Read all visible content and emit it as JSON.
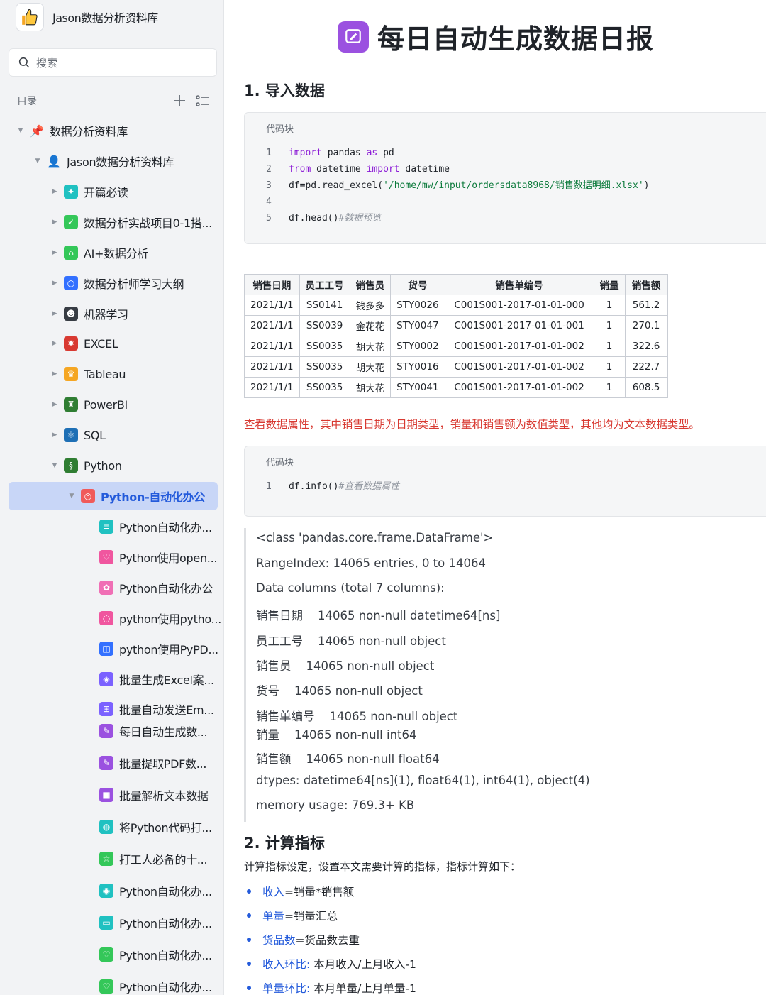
{
  "app": {
    "title": "Jason数据分析资料库",
    "logo_icon": "thumbs-up-icon"
  },
  "search": {
    "placeholder": "搜索"
  },
  "toc": {
    "title": "目录"
  },
  "tree": [
    {
      "label": "数据分析资料库",
      "level": 0,
      "arrow": "▼",
      "icon": "pin-icon",
      "glyph": "📌",
      "color": "transparent"
    },
    {
      "label": "Jason数据分析资料库",
      "level": 1,
      "arrow": "▼",
      "icon": "user-icon",
      "glyph": "👤",
      "color": "transparent"
    },
    {
      "label": "开篇必读",
      "level": 2,
      "arrow": "▶",
      "icon": "book-icon",
      "glyph": "✦",
      "color": "#20c1c1"
    },
    {
      "label": "数据分析实战项目0-1搭...",
      "level": 2,
      "arrow": "▶",
      "icon": "check-icon",
      "glyph": "✓",
      "color": "#34c759"
    },
    {
      "label": "AI+数据分析",
      "level": 2,
      "arrow": "▶",
      "icon": "home-icon",
      "glyph": "⌂",
      "color": "#34c759"
    },
    {
      "label": "数据分析师学习大纲",
      "level": 2,
      "arrow": "▶",
      "icon": "circle-icon",
      "glyph": "○",
      "color": "#3370ff"
    },
    {
      "label": "机器学习",
      "level": 2,
      "arrow": "▶",
      "icon": "mask-icon",
      "glyph": "☻",
      "color": "#373c43"
    },
    {
      "label": "EXCEL",
      "level": 2,
      "arrow": "▶",
      "icon": "bug-icon",
      "glyph": "✹",
      "color": "#d83931"
    },
    {
      "label": "Tableau",
      "level": 2,
      "arrow": "▶",
      "icon": "crown-icon",
      "glyph": "♛",
      "color": "#f5a623"
    },
    {
      "label": "PowerBI",
      "level": 2,
      "arrow": "▶",
      "icon": "trophy-icon",
      "glyph": "♜",
      "color": "#2f7d32"
    },
    {
      "label": "SQL",
      "level": 2,
      "arrow": "▶",
      "icon": "atom-icon",
      "glyph": "⚛",
      "color": "#1e6fb5"
    },
    {
      "label": "Python",
      "level": 2,
      "arrow": "▼",
      "icon": "snake-icon",
      "glyph": "§",
      "color": "#2f7d32"
    },
    {
      "label": "Python-自动化办公",
      "level": 3,
      "arrow": "▼",
      "icon": "target-icon",
      "glyph": "◎",
      "color": "#f05a5a",
      "selected": true
    },
    {
      "label": "Python自动化办...",
      "level": 4,
      "arrow": "",
      "icon": "doc-icon",
      "glyph": "≡",
      "color": "#20c1c1"
    },
    {
      "label": "Python使用open...",
      "level": 4,
      "arrow": "",
      "icon": "heart-icon",
      "glyph": "♡",
      "color": "#f0569f"
    },
    {
      "label": "Python自动化办公",
      "level": 4,
      "arrow": "",
      "icon": "flower-icon",
      "glyph": "✿",
      "color": "#f06fb5"
    },
    {
      "label": "python使用pytho...",
      "level": 4,
      "arrow": "",
      "icon": "ring-icon",
      "glyph": "◌",
      "color": "#f0569f"
    },
    {
      "label": "python使用PyPD...",
      "level": 4,
      "arrow": "",
      "icon": "gamepad-icon",
      "glyph": "◫",
      "color": "#3370ff"
    },
    {
      "label": "批量生成Excel案...",
      "level": 4,
      "arrow": "",
      "icon": "shield-icon",
      "glyph": "◈",
      "color": "#7b61ff"
    },
    {
      "label": "批量自动发送Em...",
      "level": 4,
      "arrow": "",
      "icon": "grid-icon",
      "glyph": "⊞",
      "color": "#7b61ff"
    },
    {
      "label": "每日自动生成数...",
      "level": 4,
      "arrow": "",
      "icon": "chat-icon",
      "glyph": "✎",
      "color": "#9b51e0"
    },
    {
      "label": "批量提取PDF数...",
      "level": 4,
      "arrow": "",
      "icon": "edit-icon",
      "glyph": "✎",
      "color": "#9b51e0"
    },
    {
      "label": "批量解析文本数据",
      "level": 4,
      "arrow": "",
      "icon": "image-icon",
      "glyph": "▣",
      "color": "#9b51e0"
    },
    {
      "label": "将Python代码打...",
      "level": 4,
      "arrow": "",
      "icon": "package-icon",
      "glyph": "◍",
      "color": "#20c1c1"
    },
    {
      "label": "打工人必备的十...",
      "level": 4,
      "arrow": "",
      "icon": "star-icon",
      "glyph": "☆",
      "color": "#34c759"
    },
    {
      "label": "Python自动化办...",
      "level": 4,
      "arrow": "",
      "icon": "globe-icon",
      "glyph": "◉",
      "color": "#20c1c1"
    },
    {
      "label": "Python自动化办...",
      "level": 4,
      "arrow": "",
      "icon": "folder-icon",
      "glyph": "▭",
      "color": "#20c1c1"
    },
    {
      "label": "Python自动化办...",
      "level": 4,
      "arrow": "",
      "icon": "shield-check-icon",
      "glyph": "♡",
      "color": "#34c759"
    },
    {
      "label": "Python自动化办...",
      "level": 4,
      "arrow": "",
      "icon": "shield-check-icon",
      "glyph": "♡",
      "color": "#34c759"
    }
  ],
  "doc": {
    "title": "每日自动生成数据日报",
    "section1": "1. 导入数据",
    "code1_label": "代码块",
    "code1": [
      {
        "n": "1",
        "parts": [
          [
            "kw",
            "import"
          ],
          [
            "t",
            " pandas "
          ],
          [
            "kw",
            "as"
          ],
          [
            "t",
            " pd"
          ]
        ]
      },
      {
        "n": "2",
        "parts": [
          [
            "kw",
            "from"
          ],
          [
            "t",
            " datetime "
          ],
          [
            "kw",
            "import"
          ],
          [
            "t",
            " datetime"
          ]
        ]
      },
      {
        "n": "3",
        "parts": [
          [
            "t",
            "df=pd.read_excel("
          ],
          [
            "str",
            "'/home/mw/input/ordersdata8968/销售数据明细.xlsx'"
          ],
          [
            "t",
            ")"
          ]
        ]
      },
      {
        "n": "4",
        "parts": []
      },
      {
        "n": "5",
        "parts": [
          [
            "t",
            "df.head()"
          ],
          [
            "cmt",
            "#数据预览"
          ]
        ]
      }
    ],
    "table": {
      "headers": [
        "销售日期",
        "员工工号",
        "销售员",
        "货号",
        "销售单编号",
        "销量",
        "销售额"
      ],
      "rows": [
        [
          "2021/1/1",
          "SS0141",
          "钱多多",
          "STY0026",
          "C001S001-2017-01-01-000",
          "1",
          "561.2"
        ],
        [
          "2021/1/1",
          "SS0039",
          "金花花",
          "STY0047",
          "C001S001-2017-01-01-001",
          "1",
          "270.1"
        ],
        [
          "2021/1/1",
          "SS0035",
          "胡大花",
          "STY0002",
          "C001S001-2017-01-01-002",
          "1",
          "322.6"
        ],
        [
          "2021/1/1",
          "SS0035",
          "胡大花",
          "STY0016",
          "C001S001-2017-01-01-002",
          "1",
          "222.7"
        ],
        [
          "2021/1/1",
          "SS0035",
          "胡大花",
          "STY0041",
          "C001S001-2017-01-01-002",
          "1",
          "608.5"
        ]
      ]
    },
    "note": "查看数据属性，其中销售日期为日期类型，销量和销售额为数值类型，其他均为文本数据类型。",
    "code2_label": "代码块",
    "code2": [
      {
        "n": "1",
        "parts": [
          [
            "t",
            "df.info()"
          ],
          [
            "cmt",
            "#查看数据属性"
          ]
        ]
      }
    ],
    "output": [
      "<class 'pandas.core.frame.DataFrame'>",
      "RangeIndex: 14065 entries, 0 to 14064",
      "Data columns (total 7 columns):",
      "销售日期    14065 non-null datetime64[ns]",
      "员工工号    14065 non-null object",
      "销售员    14065 non-null object",
      "货号    14065 non-null object",
      "销售单编号    14065 non-null object",
      "销量    14065 non-null int64",
      "销售额    14065 non-null float64",
      "dtypes: datetime64[ns](1), float64(1), int64(1), object(4)",
      "memory usage: 769.3+ KB"
    ],
    "section2": "2. 计算指标",
    "para": "计算指标设定，设置本文需要计算的指标，指标计算如下：",
    "bullets": [
      {
        "term": "收入",
        "rest": "=销量*销售额"
      },
      {
        "term": "单量",
        "rest": "=销量汇总"
      },
      {
        "term": "货品数",
        "rest": "=货品数去重"
      },
      {
        "term": "收入环比:",
        "rest": " 本月收入/上月收入-1"
      },
      {
        "term": "单量环比:",
        "rest": " 本月单量/上月单量-1"
      }
    ]
  }
}
